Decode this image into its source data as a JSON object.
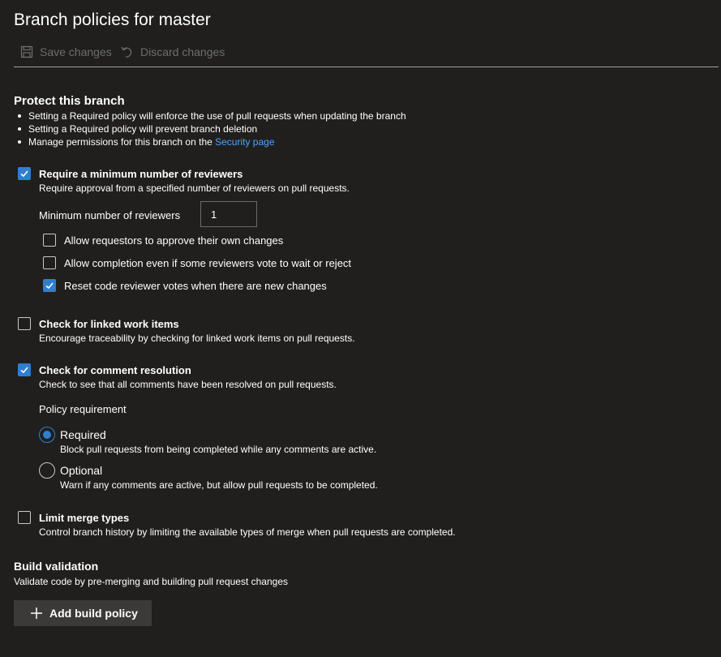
{
  "page": {
    "title": "Branch policies for master"
  },
  "toolbar": {
    "save_label": "Save changes",
    "discard_label": "Discard changes"
  },
  "protect": {
    "heading": "Protect this branch",
    "bullets": [
      "Setting a Required policy will enforce the use of pull requests when updating the branch",
      "Setting a Required policy will prevent branch deletion",
      "Manage permissions for this branch on the "
    ],
    "security_link": "Security page"
  },
  "reviewers": {
    "title": "Require a minimum number of reviewers",
    "desc": "Require approval from a specified number of reviewers on pull requests.",
    "checked": true,
    "min_label": "Minimum number of reviewers",
    "min_value": "1",
    "options": [
      {
        "label": "Allow requestors to approve their own changes",
        "checked": false
      },
      {
        "label": "Allow completion even if some reviewers vote to wait or reject",
        "checked": false
      },
      {
        "label": "Reset code reviewer votes when there are new changes",
        "checked": true
      }
    ]
  },
  "linked": {
    "title": "Check for linked work items",
    "desc": "Encourage traceability by checking for linked work items on pull requests.",
    "checked": false
  },
  "comments": {
    "title": "Check for comment resolution",
    "desc": "Check to see that all comments have been resolved on pull requests.",
    "checked": true,
    "policy_label": "Policy requirement",
    "required": {
      "title": "Required",
      "desc": "Block pull requests from being completed while any comments are active.",
      "selected": true
    },
    "optional": {
      "title": "Optional",
      "desc": "Warn if any comments are active, but allow pull requests to be completed.",
      "selected": false
    }
  },
  "merge": {
    "title": "Limit merge types",
    "desc": "Control branch history by limiting the available types of merge when pull requests are completed.",
    "checked": false
  },
  "build": {
    "heading": "Build validation",
    "desc": "Validate code by pre-merging and building pull request changes",
    "add_label": "Add build policy"
  },
  "colors": {
    "accent": "#2d7fd0",
    "link": "#4fa3ff",
    "background": "#201f1e",
    "button": "#3b3a39"
  }
}
